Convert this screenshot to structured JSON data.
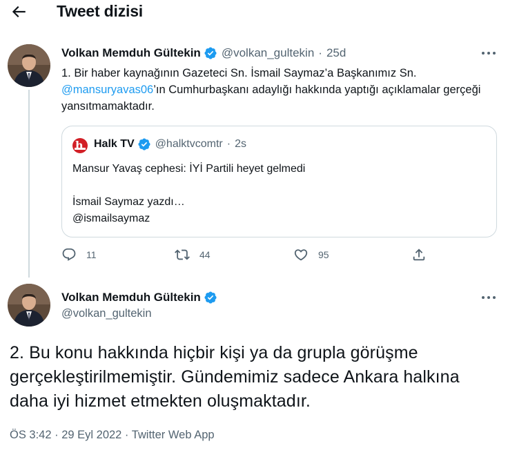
{
  "header": {
    "title": "Tweet dizisi",
    "back_icon": "arrow-left-icon"
  },
  "colors": {
    "accent": "#1d9bf0",
    "text": "#0f1419",
    "muted": "#536471",
    "border": "#cfd9de",
    "halktv_red": "#d21f26"
  },
  "tweet1": {
    "name": "Volkan Memduh Gültekin",
    "handle": "@volkan_gultekin",
    "separator": "·",
    "time": "25d",
    "text_before": "1. Bir haber kaynağının Gazeteci Sn. İsmail Saymaz’a Başkanımız Sn. ",
    "mention": "@mansuryavas06",
    "text_after": "’ın Cumhurbaşkanı adaylığı hakkında yaptığı açıklamalar gerçeği yansıtmamaktadır.",
    "quote": {
      "name": "Halk TV",
      "handle": "@halktvcomtr",
      "separator": "·",
      "time": "2s",
      "line1": "Mansur Yavaş cephesi: İYİ Partili heyet gelmedi",
      "line2": "İsmail Saymaz yazdı…",
      "line3": "@ismailsaymaz"
    },
    "actions": {
      "reply_count": "11",
      "retweet_count": "44",
      "like_count": "95"
    }
  },
  "tweet2": {
    "name": "Volkan Memduh Gültekin",
    "handle": "@volkan_gultekin",
    "text": "2. Bu konu hakkında hiçbir kişi ya da grupla görüşme gerçekleştirilmemiştir. Gündemimiz sadece Ankara halkına daha iyi hizmet etmekten oluşmaktadır.",
    "meta": "ÖS 3:42 · 29 Eyl 2022 · Twitter Web App"
  }
}
